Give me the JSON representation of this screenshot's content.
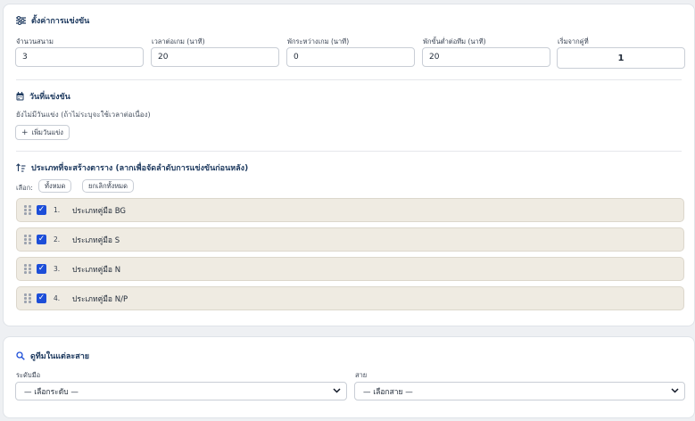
{
  "settings": {
    "title": "ตั้งค่าการแข่งขัน",
    "fields": [
      {
        "label": "จำนวนสนาม",
        "value": "3"
      },
      {
        "label": "เวลาต่อเกม (นาที)",
        "value": "20"
      },
      {
        "label": "พักระหว่างเกม (นาที)",
        "value": "0"
      },
      {
        "label": "พักขั้นต่ำต่อทีม (นาที)",
        "value": "20"
      },
      {
        "label": "เริ่มจากคู่ที่",
        "value": "1"
      }
    ]
  },
  "dates": {
    "title": "วันที่แข่งขัน",
    "empty_text": "ยังไม่มีวันแข่ง (ถ้าไม่ระบุจะใช้เวลาต่อเนื่อง)",
    "add_button": "เพิ่มวันแข่ง",
    "add_icon": "+"
  },
  "categories": {
    "title": "ประเภทที่จะสร้างตาราง (ลากเพื่อจัดลำดับการแข่งขันก่อนหลัง)",
    "select_label": "เลือก:",
    "select_all": "ทั้งหมด",
    "deselect_all": "ยกเลิกทั้งหมด",
    "items": [
      {
        "num": "1.",
        "label": "ประเภทคู่มือ BG",
        "checked": true
      },
      {
        "num": "2.",
        "label": "ประเภทคู่มือ S",
        "checked": true
      },
      {
        "num": "3.",
        "label": "ประเภทคู่มือ N",
        "checked": true
      },
      {
        "num": "4.",
        "label": "ประเภทคู่มือ N/P",
        "checked": true
      }
    ]
  },
  "lines": {
    "title": "ดูทีมในแต่ละสาย",
    "level_label": "ระดับมือ",
    "level_value": "— เลือกระดับ —",
    "line_label": "สาย",
    "line_value": "— เลือกสาย —"
  },
  "colors": {
    "accent": "#1d4ed8",
    "title": "#1e3a5f",
    "row_bg": "#efebe2"
  }
}
